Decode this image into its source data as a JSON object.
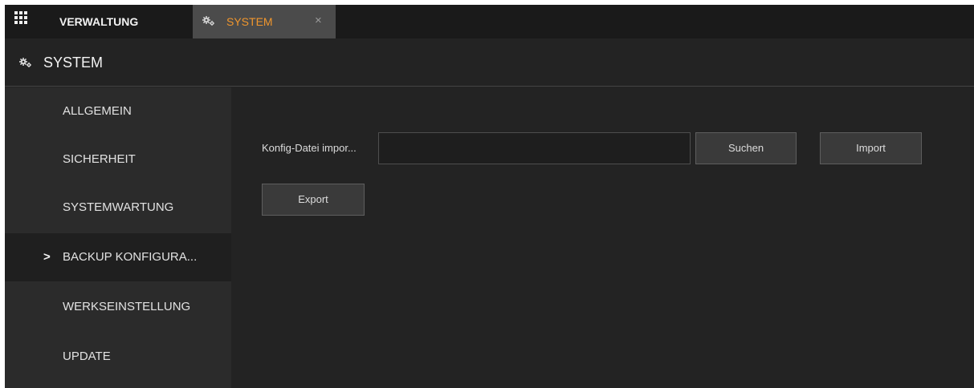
{
  "topbar": {
    "menu_icon": "grid-icon",
    "tabs": [
      {
        "label": "VERWALTUNG"
      },
      {
        "label": "SYSTEM",
        "icon": "gears-icon",
        "close": "×",
        "active_color": "#f0962d"
      }
    ]
  },
  "header": {
    "icon": "gears-icon",
    "title": "SYSTEM"
  },
  "sidebar": {
    "items": [
      {
        "label": "ALLGEMEIN"
      },
      {
        "label": "SICHERHEIT"
      },
      {
        "label": "SYSTEMWARTUNG"
      },
      {
        "label": "BACKUP KONFIGURA...",
        "active": true,
        "marker": ">"
      },
      {
        "label": "WERKSEINSTELLUNG"
      },
      {
        "label": "UPDATE"
      }
    ]
  },
  "main": {
    "import_label": "Konfig-Datei impor...",
    "file_value": "",
    "search_button": "Suchen",
    "import_button": "Import",
    "export_button": "Export"
  },
  "colors": {
    "accent": "#f0962d",
    "background": "#232323",
    "sidebar": "#2b2b2b"
  }
}
